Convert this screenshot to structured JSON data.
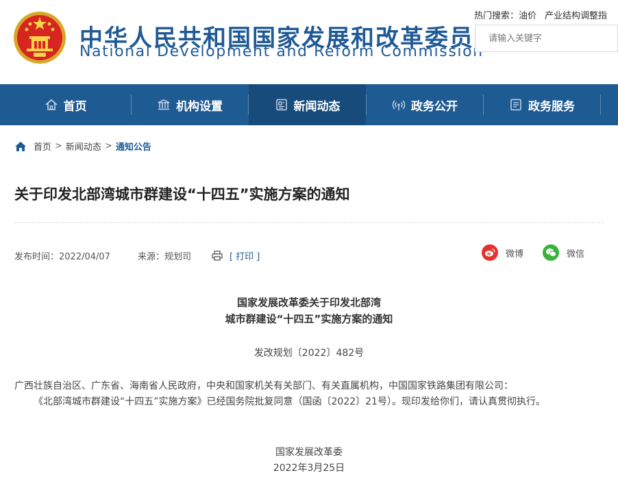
{
  "header": {
    "title_cn": "中华人民共和国国家发展和改革委员会",
    "title_en": "National Development and Reform Commission",
    "hot_label": "热门搜索：",
    "hot_keywords": [
      "油价",
      "产业结构调整指"
    ],
    "search_placeholder": "请输入关键字"
  },
  "nav": {
    "items": [
      {
        "label": "首页",
        "icon": "home-icon"
      },
      {
        "label": "机构设置",
        "icon": "institution-icon"
      },
      {
        "label": "新闻动态",
        "icon": "news-icon",
        "active": true
      },
      {
        "label": "政务公开",
        "icon": "broadcast-icon"
      },
      {
        "label": "政务服务",
        "icon": "service-icon"
      }
    ],
    "bg_color": "#1f5b93",
    "active_color": "#174b7c"
  },
  "breadcrumb": {
    "items": [
      "首页",
      "新闻动态"
    ],
    "separator": ">",
    "current": "通知公告"
  },
  "article": {
    "title": "关于印发北部湾城市群建设“十四五”实施方案的通知",
    "publish_label": "发布时间：2022/04/07",
    "source_label": "来源：规划司",
    "print_label": "[ 打印 ]",
    "share": [
      {
        "label": "微博",
        "icon": "weibo-icon",
        "color": "#e6312d"
      },
      {
        "label": "微信",
        "icon": "wechat-icon",
        "color": "#3bb33b"
      }
    ],
    "doc_title_line1": "国家发展改革委关于印发北部湾",
    "doc_title_line2": "城市群建设“十四五”实施方案的通知",
    "doc_number": "发改规划〔2022〕482号",
    "recipients": "广西壮族自治区、广东省、海南省人民政府，中央和国家机关有关部门、有关直属机构，中国国家铁路集团有限公司：",
    "body": "《北部湾城市群建设“十四五”实施方案》已经国务院批复同意（国函〔2022〕21号）。现印发给你们，请认真贯彻执行。",
    "signature": "国家发展改革委",
    "sign_date": "2022年3月25日"
  }
}
